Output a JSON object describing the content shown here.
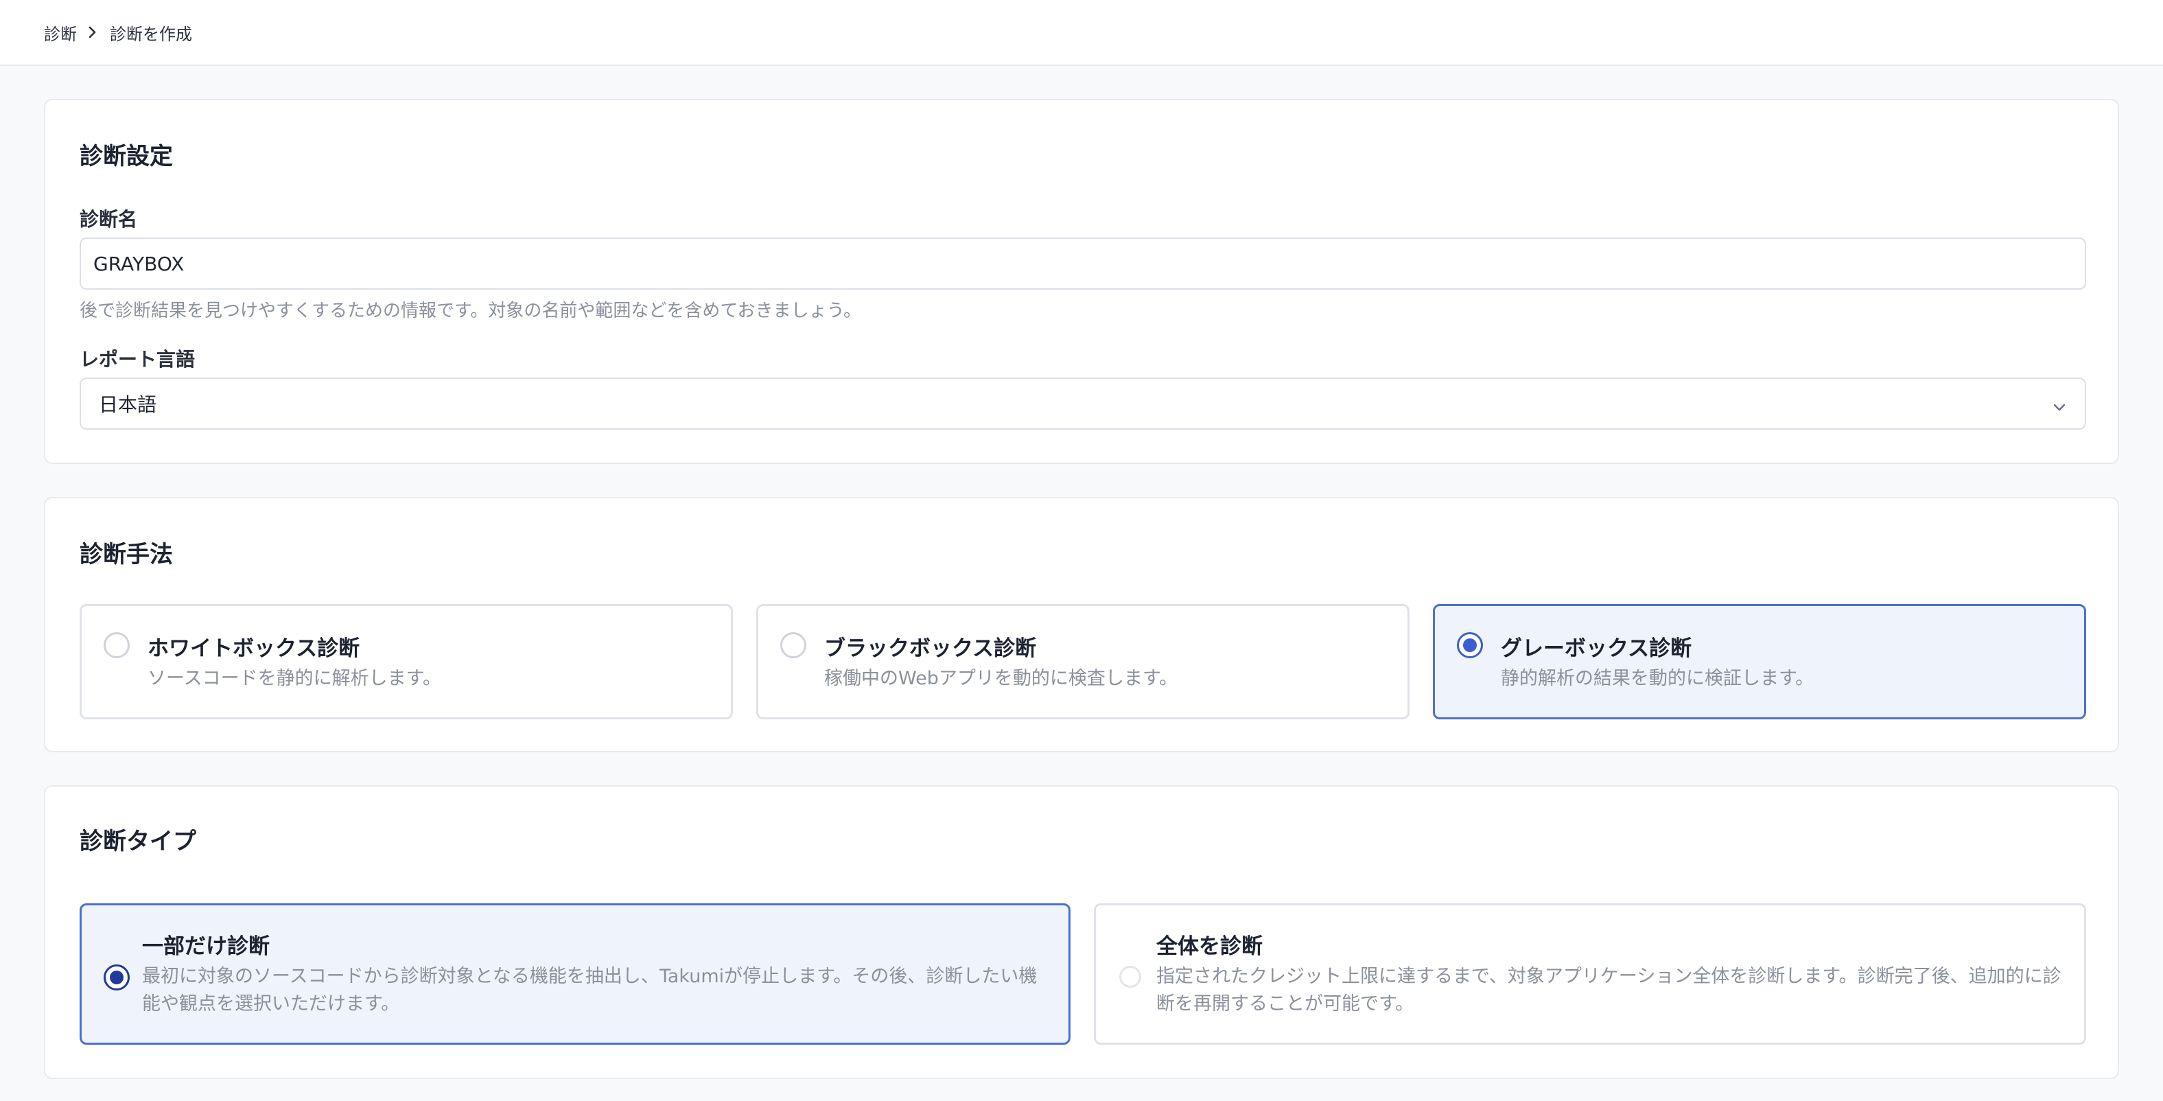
{
  "breadcrumb": {
    "items": [
      "診断",
      "診断を作成"
    ]
  },
  "settings": {
    "title": "診断設定",
    "name_label": "診断名",
    "name_value": "GRAYBOX",
    "name_help": "後で診断結果を見つけやすくするための情報です。対象の名前や範囲などを含めておきましょう。",
    "language_label": "レポート言語",
    "language_value": "日本語"
  },
  "method": {
    "title": "診断手法",
    "options": [
      {
        "title": "ホワイトボックス診断",
        "desc": "ソースコードを静的に解析します。",
        "selected": false
      },
      {
        "title": "ブラックボックス診断",
        "desc": "稼働中のWebアプリを動的に検査します。",
        "selected": false
      },
      {
        "title": "グレーボックス診断",
        "desc": "静的解析の結果を動的に検証します。",
        "selected": true
      }
    ]
  },
  "type": {
    "title": "診断タイプ",
    "options": [
      {
        "title": "一部だけ診断",
        "desc": "最初に対象のソースコードから診断対象となる機能を抽出し、Takumiが停止します。その後、診断したい機能や観点を選択いただけます。",
        "selected": true
      },
      {
        "title": "全体を診断",
        "desc": "指定されたクレジット上限に達するまで、対象アプリケーション全体を診断します。診断完了後、追加的に診断を再開することが可能です。",
        "selected": false
      }
    ]
  },
  "colors": {
    "accent": "#3a5fd0",
    "selected_bg": "#eff3fc",
    "muted_text": "#8b909b"
  }
}
